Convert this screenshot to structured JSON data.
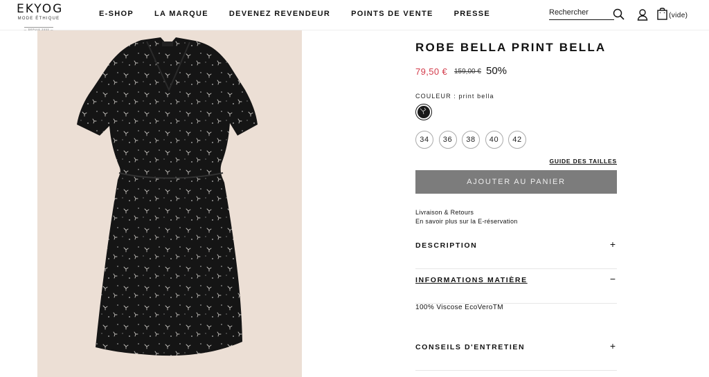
{
  "header": {
    "logo": {
      "name": "EKYOG",
      "tagline": "MODE ÉTHIQUE",
      "since": "— DEPUIS 2003 —"
    },
    "nav": [
      "E-SHOP",
      "LA MARQUE",
      "DEVENEZ REVENDEUR",
      "POINTS DE VENTE",
      "PRESSE"
    ],
    "search_placeholder": "Rechercher",
    "cart_label": "(vide)"
  },
  "product": {
    "title": "ROBE BELLA PRINT BELLA",
    "price": "79,50 €",
    "old_price": "159,00 €",
    "discount": "50%",
    "color_label": "COULEUR : print bella",
    "sizes": [
      "34",
      "36",
      "38",
      "40",
      "42"
    ],
    "size_guide": "GUIDE DES TAILLES",
    "add_to_cart": "AJOUTER AU PANIER",
    "delivery_line1": "Livraison & Retours",
    "delivery_line2": "En savoir plus sur la E-réservation"
  },
  "accordion": [
    {
      "title": "DESCRIPTION",
      "toggle": "+",
      "open": false
    },
    {
      "title": "INFORMATIONS MATIÈRE",
      "toggle": "−",
      "open": true,
      "content": "100% Viscose EcoVeroTM"
    },
    {
      "title": "CONSEILS D'ENTRETIEN",
      "toggle": "+",
      "open": false
    }
  ],
  "colors": {
    "price": "#d33a4a",
    "button_bg": "#7c7c7c",
    "image_bg": "#ecdfd5"
  }
}
